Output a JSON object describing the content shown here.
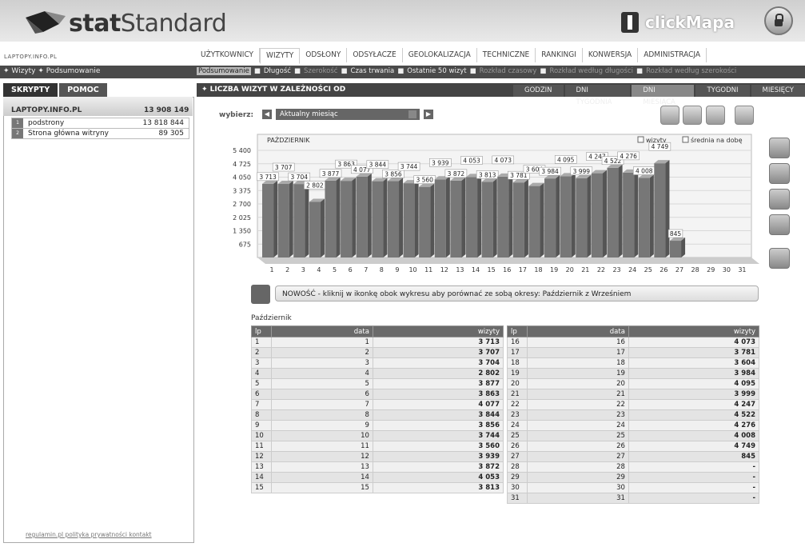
{
  "header": {
    "logo_bold": "stat",
    "logo_rest": "Standard",
    "clickmapa": "clickMapa"
  },
  "site_url": "LAPTOPY.INFO.PL",
  "main_menu": [
    "UŻYTKOWNICY",
    "WIZYTY",
    "ODSŁONY",
    "ODSYŁACZE",
    "GEOLOKALIZACJA",
    "TECHNICZNE",
    "RANKINGI",
    "KONWERSJA",
    "ADMINISTRACJA"
  ],
  "breadcrumb": "✦ Wizyty ✦ Podsumowanie",
  "sub_menu": [
    {
      "label": "Podsumowanie",
      "state": "active"
    },
    {
      "label": "Długość",
      "state": "normal"
    },
    {
      "label": "Szerokość",
      "state": "dim"
    },
    {
      "label": "Czas trwania",
      "state": "normal"
    },
    {
      "label": "Ostatnie 50 wizyt",
      "state": "normal"
    },
    {
      "label": "Rozkład czasowy",
      "state": "dim"
    },
    {
      "label": "Rozkład według długości",
      "state": "dim"
    },
    {
      "label": "Rozkład według szerokości",
      "state": "dim"
    }
  ],
  "left_tabs": [
    "SKRYPTY",
    "POMOC"
  ],
  "left_panel": {
    "site": "LAPTOPY.INFO.PL",
    "total": "13 908 149",
    "rows": [
      {
        "num": "1",
        "label": "podstrony",
        "value": "13 818 844"
      },
      {
        "num": "2",
        "label": "Strona główna witryny",
        "value": "89 305"
      }
    ]
  },
  "footer_links": "regulamin.pl  polityka prywatności  kontakt",
  "section": {
    "title": "✦ LICZBA WIZYT W ZALEŻNOŚCI OD",
    "tabs": [
      "GODZIN",
      "DNI TYGODNIA",
      "DNI MIESIĄCA",
      "TYGODNI",
      "MIESIĘCY"
    ],
    "active_tab": 2
  },
  "controls": {
    "wybierz": "wybierz:",
    "month": "Aktualny miesiąc"
  },
  "chart_data": {
    "type": "bar",
    "title": "PAŹDZIERNIK",
    "legend": [
      "wizyty",
      "średnia na dobę"
    ],
    "legend_position": "top-right",
    "categories": [
      "1",
      "2",
      "3",
      "4",
      "5",
      "6",
      "7",
      "8",
      "9",
      "10",
      "11",
      "12",
      "13",
      "14",
      "15",
      "16",
      "17",
      "18",
      "19",
      "20",
      "21",
      "22",
      "23",
      "24",
      "25",
      "26",
      "27",
      "28",
      "29",
      "30",
      "31"
    ],
    "values": [
      3713,
      3707,
      3704,
      2802,
      3877,
      3863,
      4077,
      3844,
      3856,
      3744,
      3560,
      3939,
      3872,
      4053,
      3813,
      4073,
      3781,
      3604,
      3984,
      4095,
      3999,
      4247,
      4522,
      4276,
      4008,
      4749,
      845,
      null,
      null,
      null,
      null
    ],
    "bar_labels": [
      "3 713",
      "3 707",
      "3 704",
      "2 802",
      "3 877",
      "3 863",
      "4 077",
      "3 844",
      "3 856",
      "3 744",
      "3 560",
      "3 939",
      "3 872",
      "4 053",
      "3 813",
      "4 073",
      "3 781",
      "3 604",
      "3 984",
      "4 095",
      "3 999",
      "4 247",
      "4 522",
      "4 276",
      "4 008",
      "4 749",
      "845",
      "",
      "",
      "",
      ""
    ],
    "y_ticks": [
      "675",
      "1 350",
      "2 025",
      "2 700",
      "3 375",
      "4 050",
      "4 725",
      "5 400"
    ],
    "ylim": [
      0,
      5400
    ],
    "grid": true
  },
  "info": "NOWOŚĆ - kliknij w ikonkę obok wykresu aby porównać ze sobą okresy: Październik z Wrześniem",
  "table_caption": "Październik",
  "table_headers": [
    "lp",
    "data",
    "wizyty"
  ],
  "table_left": [
    [
      "1",
      "1",
      "3 713"
    ],
    [
      "2",
      "2",
      "3 707"
    ],
    [
      "3",
      "3",
      "3 704"
    ],
    [
      "4",
      "4",
      "2 802"
    ],
    [
      "5",
      "5",
      "3 877"
    ],
    [
      "6",
      "6",
      "3 863"
    ],
    [
      "7",
      "7",
      "4 077"
    ],
    [
      "8",
      "8",
      "3 844"
    ],
    [
      "9",
      "9",
      "3 856"
    ],
    [
      "10",
      "10",
      "3 744"
    ],
    [
      "11",
      "11",
      "3 560"
    ],
    [
      "12",
      "12",
      "3 939"
    ],
    [
      "13",
      "13",
      "3 872"
    ],
    [
      "14",
      "14",
      "4 053"
    ],
    [
      "15",
      "15",
      "3 813"
    ]
  ],
  "table_right": [
    [
      "16",
      "16",
      "4 073"
    ],
    [
      "17",
      "17",
      "3 781"
    ],
    [
      "18",
      "18",
      "3 604"
    ],
    [
      "19",
      "19",
      "3 984"
    ],
    [
      "20",
      "20",
      "4 095"
    ],
    [
      "21",
      "21",
      "3 999"
    ],
    [
      "22",
      "22",
      "4 247"
    ],
    [
      "23",
      "23",
      "4 522"
    ],
    [
      "24",
      "24",
      "4 276"
    ],
    [
      "25",
      "25",
      "4 008"
    ],
    [
      "26",
      "26",
      "4 749"
    ],
    [
      "27",
      "27",
      "845"
    ],
    [
      "28",
      "28",
      "-"
    ],
    [
      "29",
      "29",
      "-"
    ],
    [
      "30",
      "30",
      "-"
    ],
    [
      "31",
      "31",
      "-"
    ]
  ]
}
